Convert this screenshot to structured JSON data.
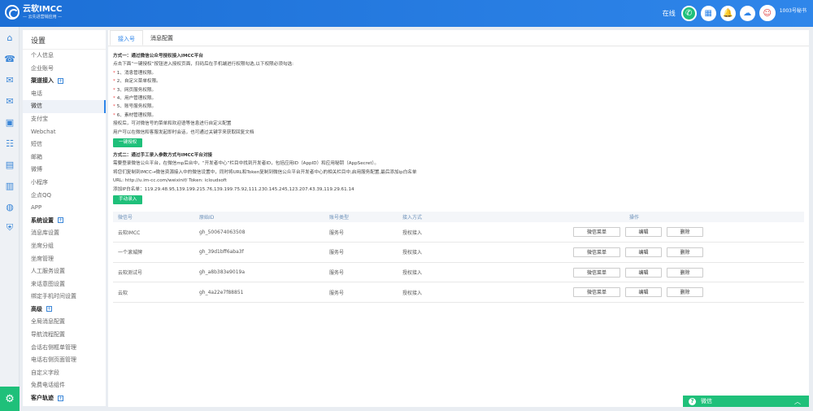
{
  "header": {
    "brand": "云软IMCC",
    "brand_sub": "— 云先进营销应用 —",
    "status": "在线",
    "user": "1003号秘书"
  },
  "rail_icons": [
    "home-icon",
    "phone-icon",
    "chat-icon",
    "mail-icon",
    "device-icon",
    "users-icon",
    "table-icon",
    "chart-icon",
    "globe-icon",
    "shield-icon"
  ],
  "nav": {
    "title": "设置",
    "items": [
      {
        "label": "个人信息",
        "type": "item"
      },
      {
        "label": "企业账号",
        "type": "item"
      },
      {
        "label": "渠道接入",
        "type": "group"
      },
      {
        "label": "电话",
        "type": "item"
      },
      {
        "label": "微信",
        "type": "item",
        "active": true
      },
      {
        "label": "支付宝",
        "type": "item"
      },
      {
        "label": "Webchat",
        "type": "item"
      },
      {
        "label": "短信",
        "type": "item"
      },
      {
        "label": "邮箱",
        "type": "item"
      },
      {
        "label": "微博",
        "type": "item"
      },
      {
        "label": "小程序",
        "type": "item"
      },
      {
        "label": "企点QQ",
        "type": "item"
      },
      {
        "label": "APP",
        "type": "item"
      },
      {
        "label": "系统设置",
        "type": "group"
      },
      {
        "label": "消息库设置",
        "type": "item"
      },
      {
        "label": "坐席分组",
        "type": "item"
      },
      {
        "label": "坐席管理",
        "type": "item"
      },
      {
        "label": "人工服务设置",
        "type": "item"
      },
      {
        "label": "来话意图设置",
        "type": "item"
      },
      {
        "label": "绑定手机时间设置",
        "type": "item"
      },
      {
        "label": "高级",
        "type": "group"
      },
      {
        "label": "全局消息配置",
        "type": "item"
      },
      {
        "label": "导航流程配置",
        "type": "item"
      },
      {
        "label": "会话右侧框单管理",
        "type": "item"
      },
      {
        "label": "电话右侧页面管理",
        "type": "item"
      },
      {
        "label": "自定义字段",
        "type": "item"
      },
      {
        "label": "免费电话组件",
        "type": "item"
      },
      {
        "label": "客户轨迹",
        "type": "group"
      }
    ]
  },
  "tabs": [
    {
      "label": "接入号",
      "active": true
    },
    {
      "label": "消息配置",
      "active": false
    }
  ],
  "method1": {
    "title": "方式一：通过微信公众号授权接入IMCC平台",
    "intro": "点击下面“一键授权”按钮进入授权页面，扫码后在手机端进行权限勾选,以下权限必须勾选:",
    "perms": [
      "1、消息管理权限。",
      "2、自定义菜单权限。",
      "3、网页服务权限。",
      "4、用户管理权限。",
      "5、账号服务权限。",
      "6、素材管理权限。"
    ],
    "note1": "授权后，可对微信号的菜单和欢迎语等信息进行自定义配置",
    "note2": "用户可以在微信和客服发起即时会话，也可通过关键字来获取回复文档",
    "button": "一键授权"
  },
  "method2": {
    "title": "方式二：通过手工录入参数方式与IMCC平台对接",
    "line1": "需要登录微信公众平台，在微信mp后台中，“开发者中心”栏目中找到开发者ID，包括应用ID（AppID）和应用秘钥（AppSecret）。",
    "line2": "将您们复制到IMCC→微信资源接入中的微信设置中，同时将URL和Token复制到微信公众平台开发者中心的相关栏目中,启用服务配置,最后添加ip白名单",
    "line3": "URL: http://u.im-cc.com/weixinif/     Token: icloudsoft",
    "line4": "添加IP白名单：119.29.48.95,139.199.215.76,139.199.75.92,111.230.145.245,123.207.43.39,119.29.61.14",
    "button": "手动录入"
  },
  "table": {
    "headers": [
      "微信号",
      "原始ID",
      "账号类型",
      "接入方式",
      "操作"
    ],
    "rows": [
      [
        "云软IMCC",
        "gh_500674063508",
        "服务号",
        "授权接入"
      ],
      [
        "一个滚城牌",
        "gh_39d1bff6aba3f",
        "服务号",
        "授权接入"
      ],
      [
        "云软测试号",
        "gh_a8b383e9019a",
        "服务号",
        "授权接入"
      ],
      [
        "云软",
        "gh_4a22e7f88851",
        "服务号",
        "授权接入"
      ]
    ],
    "actions": [
      "微信菜单",
      "编辑",
      "删除"
    ]
  },
  "footer": {
    "wechat_label": "微信"
  }
}
